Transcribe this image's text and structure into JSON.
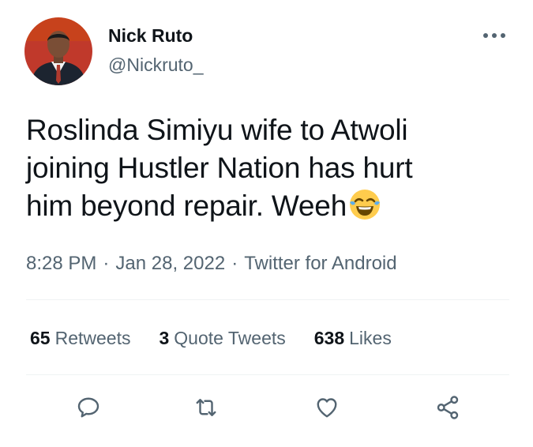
{
  "user": {
    "display_name": "Nick Ruto",
    "handle": "@Nickruto_"
  },
  "tweet": {
    "text": "Roslinda Simiyu wife to Atwoli\njoining Hustler Nation has hurt\nhim beyond repair. Weeh",
    "emoji": "face-with-tears-of-joy"
  },
  "meta": {
    "time": "8:28 PM",
    "separator": "·",
    "date": "Jan 28, 2022",
    "source": "Twitter for Android"
  },
  "stats": {
    "retweets_count": "65",
    "retweets_label": "Retweets",
    "quotes_count": "3",
    "quotes_label": "Quote Tweets",
    "likes_count": "638",
    "likes_label": "Likes"
  },
  "actions": [
    "reply-icon",
    "retweet-icon",
    "like-icon",
    "share-icon"
  ],
  "colors": {
    "text_primary": "#0f1419",
    "text_secondary": "#536471",
    "divider": "#eff3f4",
    "avatar_background": "#c0392b"
  }
}
